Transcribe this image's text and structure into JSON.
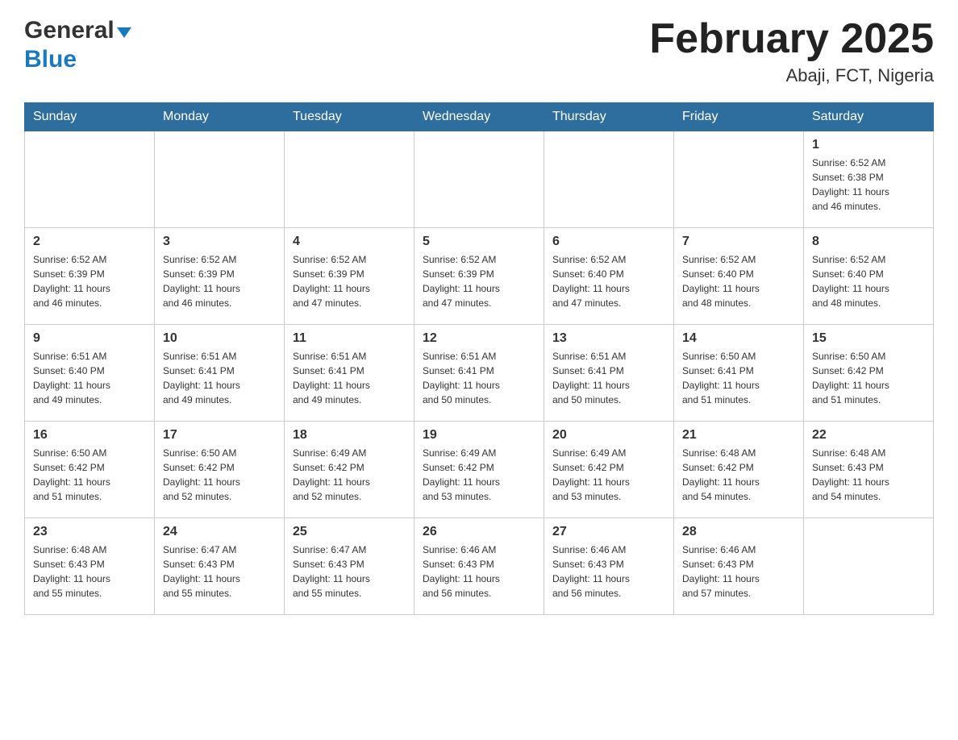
{
  "header": {
    "logo": {
      "general": "General",
      "blue": "Blue",
      "arrow": "▼"
    },
    "title": "February 2025",
    "location": "Abaji, FCT, Nigeria"
  },
  "weekdays": [
    "Sunday",
    "Monday",
    "Tuesday",
    "Wednesday",
    "Thursday",
    "Friday",
    "Saturday"
  ],
  "weeks": [
    {
      "days": [
        {
          "number": "",
          "info": ""
        },
        {
          "number": "",
          "info": ""
        },
        {
          "number": "",
          "info": ""
        },
        {
          "number": "",
          "info": ""
        },
        {
          "number": "",
          "info": ""
        },
        {
          "number": "",
          "info": ""
        },
        {
          "number": "1",
          "info": "Sunrise: 6:52 AM\nSunset: 6:38 PM\nDaylight: 11 hours\nand 46 minutes."
        }
      ]
    },
    {
      "days": [
        {
          "number": "2",
          "info": "Sunrise: 6:52 AM\nSunset: 6:39 PM\nDaylight: 11 hours\nand 46 minutes."
        },
        {
          "number": "3",
          "info": "Sunrise: 6:52 AM\nSunset: 6:39 PM\nDaylight: 11 hours\nand 46 minutes."
        },
        {
          "number": "4",
          "info": "Sunrise: 6:52 AM\nSunset: 6:39 PM\nDaylight: 11 hours\nand 47 minutes."
        },
        {
          "number": "5",
          "info": "Sunrise: 6:52 AM\nSunset: 6:39 PM\nDaylight: 11 hours\nand 47 minutes."
        },
        {
          "number": "6",
          "info": "Sunrise: 6:52 AM\nSunset: 6:40 PM\nDaylight: 11 hours\nand 47 minutes."
        },
        {
          "number": "7",
          "info": "Sunrise: 6:52 AM\nSunset: 6:40 PM\nDaylight: 11 hours\nand 48 minutes."
        },
        {
          "number": "8",
          "info": "Sunrise: 6:52 AM\nSunset: 6:40 PM\nDaylight: 11 hours\nand 48 minutes."
        }
      ]
    },
    {
      "days": [
        {
          "number": "9",
          "info": "Sunrise: 6:51 AM\nSunset: 6:40 PM\nDaylight: 11 hours\nand 49 minutes."
        },
        {
          "number": "10",
          "info": "Sunrise: 6:51 AM\nSunset: 6:41 PM\nDaylight: 11 hours\nand 49 minutes."
        },
        {
          "number": "11",
          "info": "Sunrise: 6:51 AM\nSunset: 6:41 PM\nDaylight: 11 hours\nand 49 minutes."
        },
        {
          "number": "12",
          "info": "Sunrise: 6:51 AM\nSunset: 6:41 PM\nDaylight: 11 hours\nand 50 minutes."
        },
        {
          "number": "13",
          "info": "Sunrise: 6:51 AM\nSunset: 6:41 PM\nDaylight: 11 hours\nand 50 minutes."
        },
        {
          "number": "14",
          "info": "Sunrise: 6:50 AM\nSunset: 6:41 PM\nDaylight: 11 hours\nand 51 minutes."
        },
        {
          "number": "15",
          "info": "Sunrise: 6:50 AM\nSunset: 6:42 PM\nDaylight: 11 hours\nand 51 minutes."
        }
      ]
    },
    {
      "days": [
        {
          "number": "16",
          "info": "Sunrise: 6:50 AM\nSunset: 6:42 PM\nDaylight: 11 hours\nand 51 minutes."
        },
        {
          "number": "17",
          "info": "Sunrise: 6:50 AM\nSunset: 6:42 PM\nDaylight: 11 hours\nand 52 minutes."
        },
        {
          "number": "18",
          "info": "Sunrise: 6:49 AM\nSunset: 6:42 PM\nDaylight: 11 hours\nand 52 minutes."
        },
        {
          "number": "19",
          "info": "Sunrise: 6:49 AM\nSunset: 6:42 PM\nDaylight: 11 hours\nand 53 minutes."
        },
        {
          "number": "20",
          "info": "Sunrise: 6:49 AM\nSunset: 6:42 PM\nDaylight: 11 hours\nand 53 minutes."
        },
        {
          "number": "21",
          "info": "Sunrise: 6:48 AM\nSunset: 6:42 PM\nDaylight: 11 hours\nand 54 minutes."
        },
        {
          "number": "22",
          "info": "Sunrise: 6:48 AM\nSunset: 6:43 PM\nDaylight: 11 hours\nand 54 minutes."
        }
      ]
    },
    {
      "days": [
        {
          "number": "23",
          "info": "Sunrise: 6:48 AM\nSunset: 6:43 PM\nDaylight: 11 hours\nand 55 minutes."
        },
        {
          "number": "24",
          "info": "Sunrise: 6:47 AM\nSunset: 6:43 PM\nDaylight: 11 hours\nand 55 minutes."
        },
        {
          "number": "25",
          "info": "Sunrise: 6:47 AM\nSunset: 6:43 PM\nDaylight: 11 hours\nand 55 minutes."
        },
        {
          "number": "26",
          "info": "Sunrise: 6:46 AM\nSunset: 6:43 PM\nDaylight: 11 hours\nand 56 minutes."
        },
        {
          "number": "27",
          "info": "Sunrise: 6:46 AM\nSunset: 6:43 PM\nDaylight: 11 hours\nand 56 minutes."
        },
        {
          "number": "28",
          "info": "Sunrise: 6:46 AM\nSunset: 6:43 PM\nDaylight: 11 hours\nand 57 minutes."
        },
        {
          "number": "",
          "info": ""
        }
      ]
    }
  ]
}
